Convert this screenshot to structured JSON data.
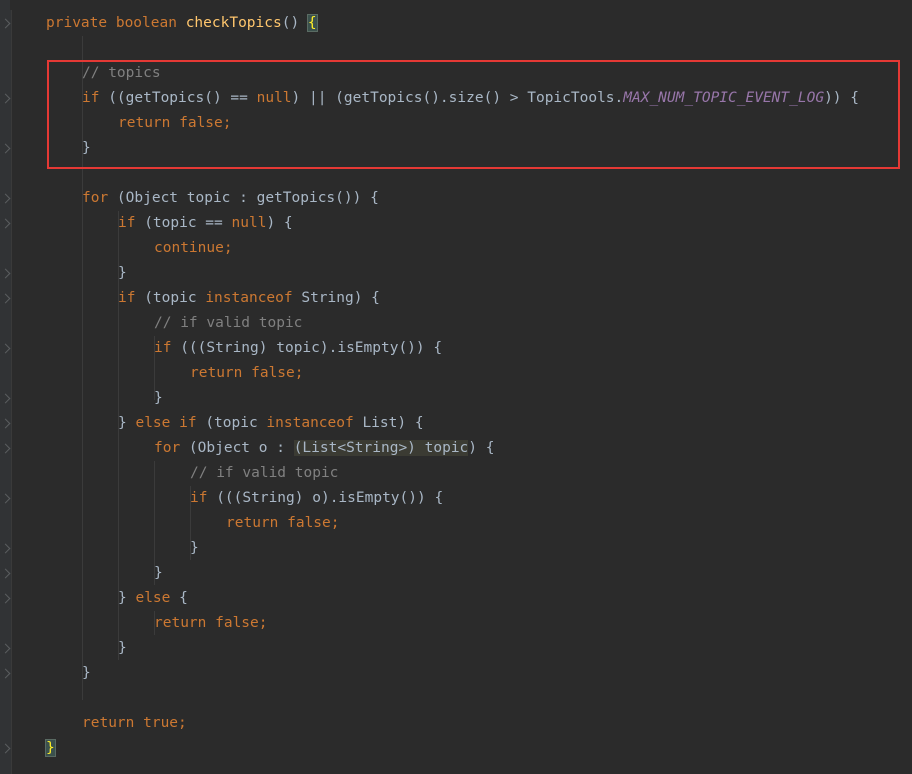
{
  "lines": [
    [
      {
        "t": "private boolean ",
        "c": "kw"
      },
      {
        "t": "checkTopics",
        "c": "fn"
      },
      {
        "t": "() "
      },
      {
        "t": "{",
        "c": "brmatch"
      }
    ],
    [],
    [
      {
        "t": "// topics",
        "c": "cm"
      }
    ],
    [
      {
        "t": "if ",
        "c": "kw"
      },
      {
        "t": "((getTopics() == "
      },
      {
        "t": "null",
        "c": "kw"
      },
      {
        "t": ") || (getTopics().size() > TopicTools."
      },
      {
        "t": "MAX_NUM_TOPIC_EVENT_LOG",
        "c": "cst"
      },
      {
        "t": ")) {"
      }
    ],
    [
      {
        "t": "return false;",
        "c": "kw"
      }
    ],
    [
      {
        "t": "}"
      }
    ],
    [],
    [
      {
        "t": "for ",
        "c": "kw"
      },
      {
        "t": "(Object topic : getTopics()) {"
      }
    ],
    [
      {
        "t": "if ",
        "c": "kw"
      },
      {
        "t": "(topic == "
      },
      {
        "t": "null",
        "c": "kw"
      },
      {
        "t": ") {"
      }
    ],
    [
      {
        "t": "continue;",
        "c": "kw"
      }
    ],
    [
      {
        "t": "}"
      }
    ],
    [
      {
        "t": "if ",
        "c": "kw"
      },
      {
        "t": "(topic "
      },
      {
        "t": "instanceof ",
        "c": "kw"
      },
      {
        "t": "String) {"
      }
    ],
    [
      {
        "t": "// if valid topic",
        "c": "cm"
      }
    ],
    [
      {
        "t": "if ",
        "c": "kw"
      },
      {
        "t": "(((String) topic).isEmpty()) {"
      }
    ],
    [
      {
        "t": "return false;",
        "c": "kw"
      }
    ],
    [
      {
        "t": "}"
      }
    ],
    [
      {
        "t": "} "
      },
      {
        "t": "else if ",
        "c": "kw"
      },
      {
        "t": "(topic "
      },
      {
        "t": "instanceof ",
        "c": "kw"
      },
      {
        "t": "List) {"
      }
    ],
    [
      {
        "t": "for ",
        "c": "kw"
      },
      {
        "t": "(Object o : "
      },
      {
        "t": "(List<String>) topic",
        "c": "hl"
      },
      {
        "t": ") {"
      }
    ],
    [
      {
        "t": "// if valid topic",
        "c": "cm"
      }
    ],
    [
      {
        "t": "if ",
        "c": "kw"
      },
      {
        "t": "(((String) o).isEmpty()) {"
      }
    ],
    [
      {
        "t": "return false;",
        "c": "kw"
      }
    ],
    [
      {
        "t": "}"
      }
    ],
    [
      {
        "t": "}"
      }
    ],
    [
      {
        "t": "} "
      },
      {
        "t": "else ",
        "c": "kw"
      },
      {
        "t": "{"
      }
    ],
    [
      {
        "t": "return false;",
        "c": "kw"
      }
    ],
    [
      {
        "t": "}"
      }
    ],
    [
      {
        "t": "}"
      }
    ],
    [],
    [
      {
        "t": "return true;",
        "c": "kw"
      }
    ],
    [
      {
        "t": "}",
        "c": "brmatch"
      }
    ]
  ]
}
